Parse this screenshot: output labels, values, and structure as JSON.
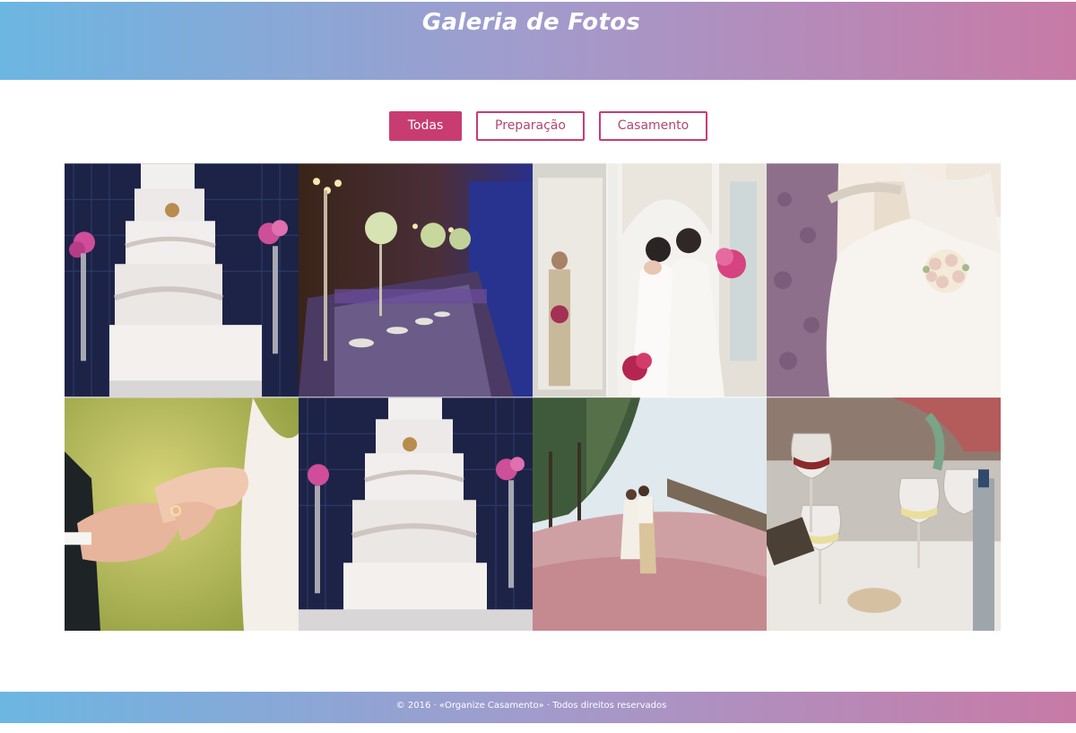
{
  "header": {
    "title": "Galeria de Fotos"
  },
  "filters": [
    {
      "label": "Todas",
      "active": true
    },
    {
      "label": "Preparação",
      "active": false
    },
    {
      "label": "Casamento",
      "active": false
    }
  ],
  "gallery": {
    "items": [
      {
        "subject": "wedding-cake"
      },
      {
        "subject": "banquet-hall"
      },
      {
        "subject": "brides-embrace"
      },
      {
        "subject": "bride-bouquet"
      },
      {
        "subject": "ring-hands"
      },
      {
        "subject": "wedding-cake"
      },
      {
        "subject": "couple-field"
      },
      {
        "subject": "wine-glasses"
      }
    ]
  },
  "footer": {
    "text": "© 2016 · «Organize Casamento» · Todos direitos reservados"
  },
  "colors": {
    "accent": "#c83c72",
    "gradient_start": "#6cb6e2",
    "gradient_end": "#c87aa6"
  }
}
